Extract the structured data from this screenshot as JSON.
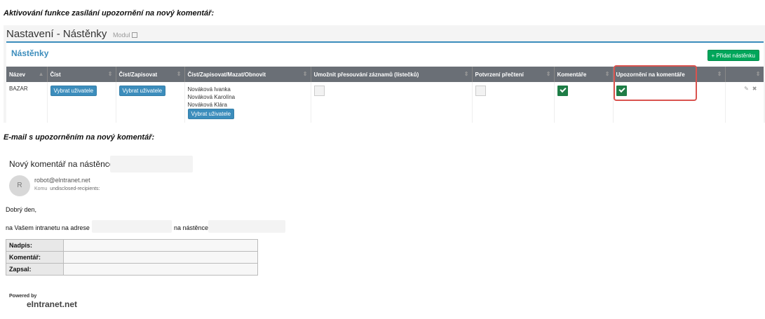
{
  "headings": {
    "activation": "Aktivování funkce zasílání upozornění na nový komentář:",
    "email": "E-mail s upozorněním na nový komentář:"
  },
  "settings": {
    "page_title": "Nastavení - Nástěnky",
    "module_link": "Modul",
    "card_title": "Nástěnky",
    "add_button": "+ Přidat nástěnku",
    "columns": [
      "Název",
      "Číst",
      "Číst/Zapisovat",
      "Číst/Zapisovat/Mazat/Obnovit",
      "Umožnit přesouvání záznamů (lístečků)",
      "Potvrzení přečtení",
      "Komentáře",
      "Upozornění na komentáře",
      ""
    ],
    "row": {
      "name": "BAZAR",
      "read_button": "Vybrat uživatele",
      "write_button": "Vybrat uživatele",
      "full_users": [
        "Nováková Ivanka",
        "Nováková Karolína",
        "Nováková Klára"
      ],
      "full_button": "Vybrat uživatele",
      "allow_move": false,
      "read_confirm": false,
      "comments": true,
      "comment_notify": true,
      "edit_icon": "pencil-icon",
      "delete_icon": "close-icon"
    }
  },
  "email": {
    "subject": "Nový komentář na nástěnce",
    "avatar_letter": "R",
    "sender": "robot@elntranet.net",
    "to_label": "Komu",
    "to_value": "undisclosed-recipients:",
    "greeting": "Dobrý den,",
    "intro": "na Vašem intranetu na adrese",
    "intro_tail": "na nástěnce",
    "fields": [
      "Nadpis:",
      "Komentář:",
      "Zapsal:"
    ],
    "powered_by": "Powered by",
    "brand": "eIntranet.net"
  },
  "colors": {
    "accent": "#3c8dbc",
    "success": "#00a65a",
    "highlight": "#d9534f"
  }
}
